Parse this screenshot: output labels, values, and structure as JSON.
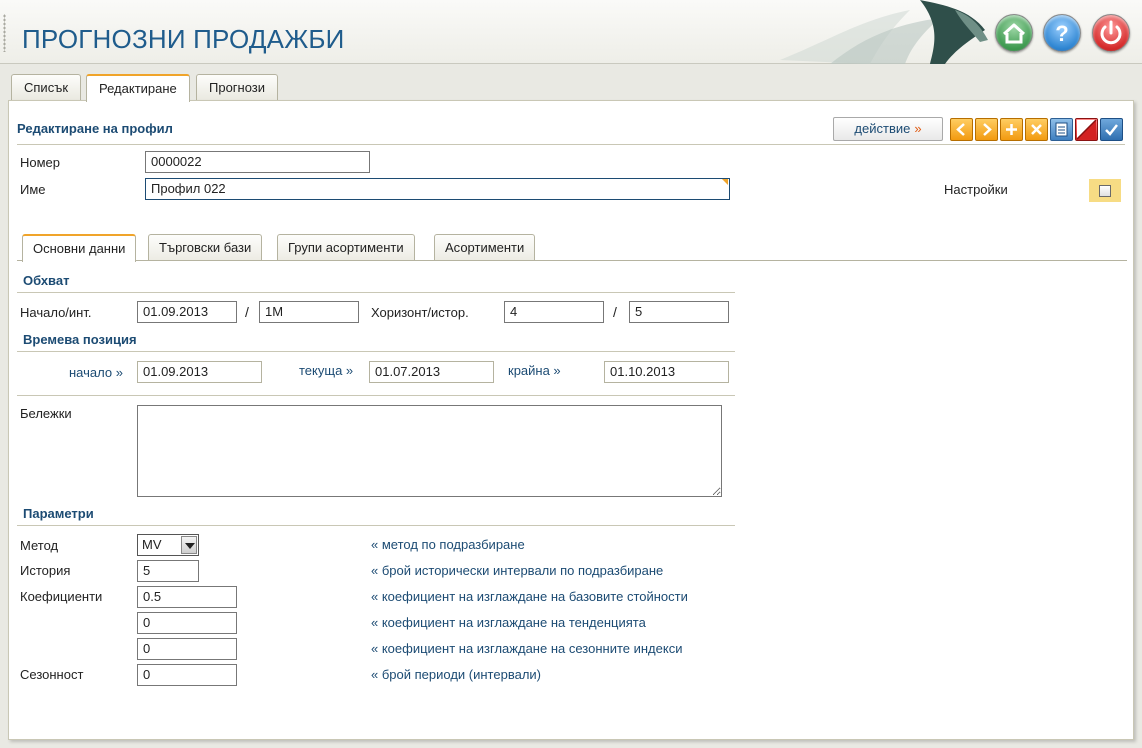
{
  "app": {
    "title": "ПРОГНОЗНИ ПРОДАЖБИ"
  },
  "tabs": [
    {
      "label": "Списък"
    },
    {
      "label": "Редактиране"
    },
    {
      "label": "Прогнози"
    }
  ],
  "panel": {
    "title": "Редактиране на профил",
    "action_label": "действие",
    "action_arrow": "»"
  },
  "profile": {
    "number_label": "Номер",
    "number_value": "0000022",
    "name_label": "Име",
    "name_value": "Профил 022",
    "settings_label": "Настройки"
  },
  "inner_tabs": [
    {
      "label": "Основни данни"
    },
    {
      "label": "Търговски бази"
    },
    {
      "label": "Групи асортименти"
    },
    {
      "label": "Асортименти"
    }
  ],
  "scope": {
    "heading": "Обхват",
    "start_label": "Начало/инт.",
    "start_value": "01.09.2013",
    "interval_value": "1M",
    "horizon_label": "Хоризонт/истор.",
    "horizon_value": "4",
    "history_value": "5"
  },
  "time_position": {
    "heading": "Времева позиция",
    "start_label": "начало »",
    "start_value": "01.09.2013",
    "current_label": "текуща »",
    "current_value": "01.07.2013",
    "end_label": "крайна »",
    "end_value": "01.10.2013"
  },
  "notes": {
    "label": "Бележки",
    "value": ""
  },
  "parameters": {
    "heading": "Параметри",
    "method_label": "Метод",
    "method_value": "MV",
    "method_hint": "« метод по подразбиране",
    "history_label": "История",
    "history_value": "5",
    "history_hint": "« брой исторически интервали по подразбиране",
    "coef_label": "Коефициенти",
    "coef1_value": "0.5",
    "coef1_hint": "« коефициент на изглаждане на базовите стойности",
    "coef2_value": "0",
    "coef2_hint": "« коефициент на изглаждане на тенденцията",
    "coef3_value": "0",
    "coef3_hint": "« коефициент на изглаждане на сезонните индекси",
    "season_label": "Сезонност",
    "season_value": "0",
    "season_hint": "« брой периоди (интервали)"
  },
  "icons": {
    "home": "home-icon",
    "help": "help-icon",
    "power": "power-icon",
    "prev": "chevron-left-icon",
    "next": "chevron-right-icon",
    "add": "plus-icon",
    "delete": "x-icon",
    "print": "print-icon",
    "cancel": "slash-icon",
    "save": "check-icon"
  },
  "colors": {
    "accent": "#f0a42a",
    "title_blue": "#1f5c8c",
    "label_blue": "#1c4b73"
  }
}
